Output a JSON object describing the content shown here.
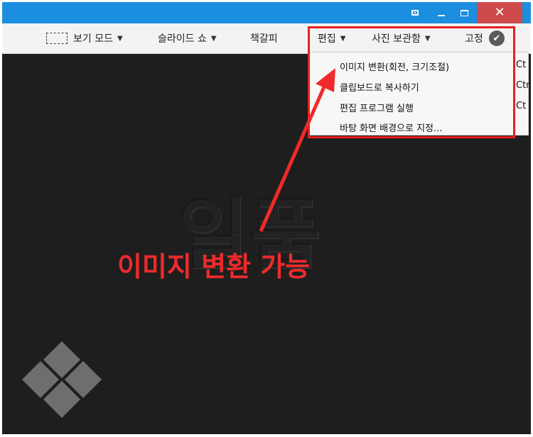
{
  "titlebar": {
    "accent": "#1c8ee0",
    "close_color": "#cf4a4a",
    "close_glyph": "✕"
  },
  "toolbar": {
    "items": [
      {
        "label": "보기 모드",
        "icon": "fullscreen-icon"
      },
      {
        "label": "슬라이드 쇼"
      },
      {
        "label": "책갈피"
      },
      {
        "label": "편집"
      },
      {
        "label": "사진 보관함"
      },
      {
        "label": "고정",
        "icon": "check-circle-icon"
      }
    ],
    "caret": "▼",
    "check": "✔"
  },
  "edit_menu": {
    "items": [
      {
        "label": "이미지 변환(회전, 크기조절)",
        "shortcut": "Ct"
      },
      {
        "label": "클립보드로 복사하기",
        "shortcut": "Ctr"
      },
      {
        "label": "편집 프로그램 실행",
        "shortcut": "Ct"
      },
      {
        "label": "바탕 화면 배경으로 지정..."
      }
    ]
  },
  "canvas": {
    "watermark": "일품",
    "annotation": "이미지 변환 가능",
    "annotation_color": "#f02a2a",
    "background": "#1e1e1e"
  }
}
